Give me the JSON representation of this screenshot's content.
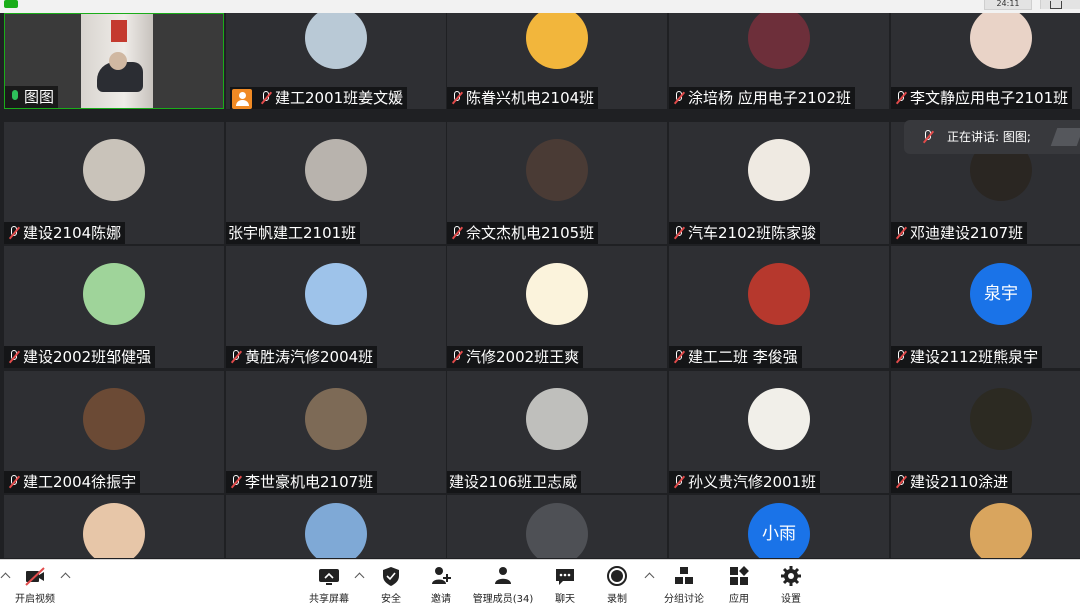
{
  "top_bar": {
    "time": "24:11"
  },
  "tiles": [
    {
      "name": "图图",
      "mic": "on",
      "video": true
    },
    {
      "name": "建工2001班姜文媛",
      "mic": "muted",
      "host_badge": true,
      "avatar_color": "#b9c9d6"
    },
    {
      "name": "陈眷兴机电2104班",
      "mic": "muted",
      "avatar_color": "#f2b63c"
    },
    {
      "name": "涂培杨 应用电子2102班",
      "mic": "muted",
      "avatar_color": "#6d2f3a"
    },
    {
      "name": "李文静应用电子2101班",
      "mic": "muted",
      "avatar_color": "#e9d3c7"
    },
    {
      "name": "建设2104陈娜",
      "mic": "muted",
      "avatar_color": "#c9c3ba"
    },
    {
      "name": "张宇帆建工2101班",
      "mic": "none",
      "avatar_color": "#b8b3ad"
    },
    {
      "name": "佘文杰机电2105班",
      "mic": "muted",
      "avatar_color": "#4a3b35"
    },
    {
      "name": "汽车2102班陈家骏",
      "mic": "muted",
      "avatar_color": "#efeae2"
    },
    {
      "name": "邓迪建设2107班",
      "mic": "muted",
      "avatar_color": "#2a2622"
    },
    {
      "name": "建设2002班邹健强",
      "mic": "muted",
      "avatar_color": "#9fd49a"
    },
    {
      "name": "黄胜涛汽修2004班",
      "mic": "muted",
      "avatar_color": "#9ec3ea"
    },
    {
      "name": "汽修2002班王爽",
      "mic": "muted",
      "avatar_color": "#fbf3dc"
    },
    {
      "name": "建工二班 李俊强",
      "mic": "muted",
      "avatar_color": "#b6382d"
    },
    {
      "name": "建设2112班熊泉宇",
      "mic": "muted",
      "avatar_letter": "泉宇",
      "avatar_color": "#1a73e8"
    },
    {
      "name": "建工2004徐振宇",
      "mic": "muted",
      "avatar_color": "#6b4a35"
    },
    {
      "name": "李世豪机电2107班",
      "mic": "muted",
      "avatar_color": "#7d6a56"
    },
    {
      "name": "建设2106班卫志威",
      "mic": "none",
      "avatar_color": "#bfbfbc"
    },
    {
      "name": "孙义贵汽修2001班",
      "mic": "muted",
      "avatar_color": "#f1efe9"
    },
    {
      "name": "建设2110涂进",
      "mic": "muted",
      "avatar_color": "#2c2a22"
    },
    {
      "name": "",
      "mic": "none",
      "avatar_color": "#e7c6a8"
    },
    {
      "name": "",
      "mic": "none",
      "avatar_color": "#7fa9d6"
    },
    {
      "name": "",
      "mic": "none",
      "avatar_color": "#4e5055"
    },
    {
      "name": "",
      "mic": "none",
      "avatar_letter": "小雨",
      "avatar_color": "#1a73e8"
    },
    {
      "name": "",
      "mic": "none",
      "avatar_color": "#d9a55e"
    }
  ],
  "speaking_indicator": {
    "text": "正在讲话: 图图;"
  },
  "toolbar": {
    "video": "开启视频",
    "share": "共享屏幕",
    "security": "安全",
    "invite": "邀请",
    "members": "管理成员(34)",
    "chat": "聊天",
    "record": "录制",
    "breakout": "分组讨论",
    "apps": "应用",
    "settings": "设置"
  },
  "colors": {
    "accent_green": "#1aad19",
    "muted_red": "#e24b4b",
    "host_orange": "#f08a24",
    "letter_avatar_blue": "#1a73e8"
  }
}
